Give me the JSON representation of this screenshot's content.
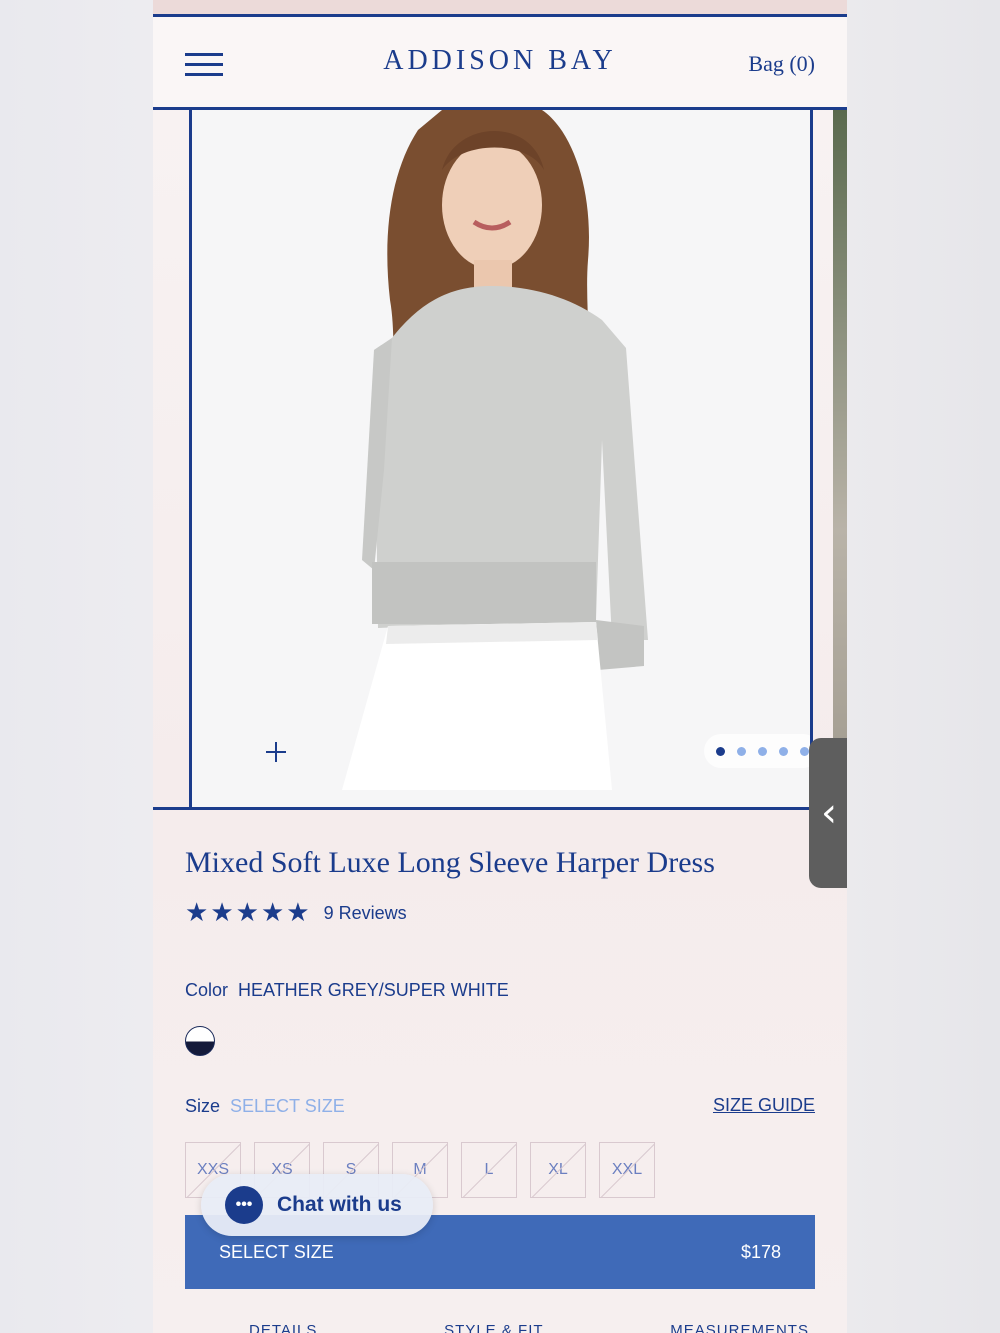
{
  "header": {
    "brand": "ADDISON BAY",
    "bag_label": "Bag (0)"
  },
  "gallery": {
    "slide_count": 5,
    "active_slide": 1
  },
  "product": {
    "title": "Mixed Soft Luxe Long Sleeve Harper Dress",
    "rating": 5,
    "reviews_label": "9 Reviews"
  },
  "color": {
    "label": "Color",
    "value": "HEATHER GREY/SUPER WHITE"
  },
  "size": {
    "label": "Size",
    "selected": "SELECT SIZE",
    "guide_label": "SIZE GUIDE",
    "options": [
      "XXS",
      "XS",
      "S",
      "M",
      "L",
      "XL",
      "XXL"
    ]
  },
  "cta": {
    "label": "SELECT SIZE",
    "price": "$178"
  },
  "chat": {
    "label": "Chat with us"
  },
  "tabs": [
    "DETAILS",
    "STYLE & FIT",
    "MEASUREMENTS"
  ],
  "colors": {
    "accent": "#1b3c8c",
    "cta_bg": "#3f6ab8"
  }
}
